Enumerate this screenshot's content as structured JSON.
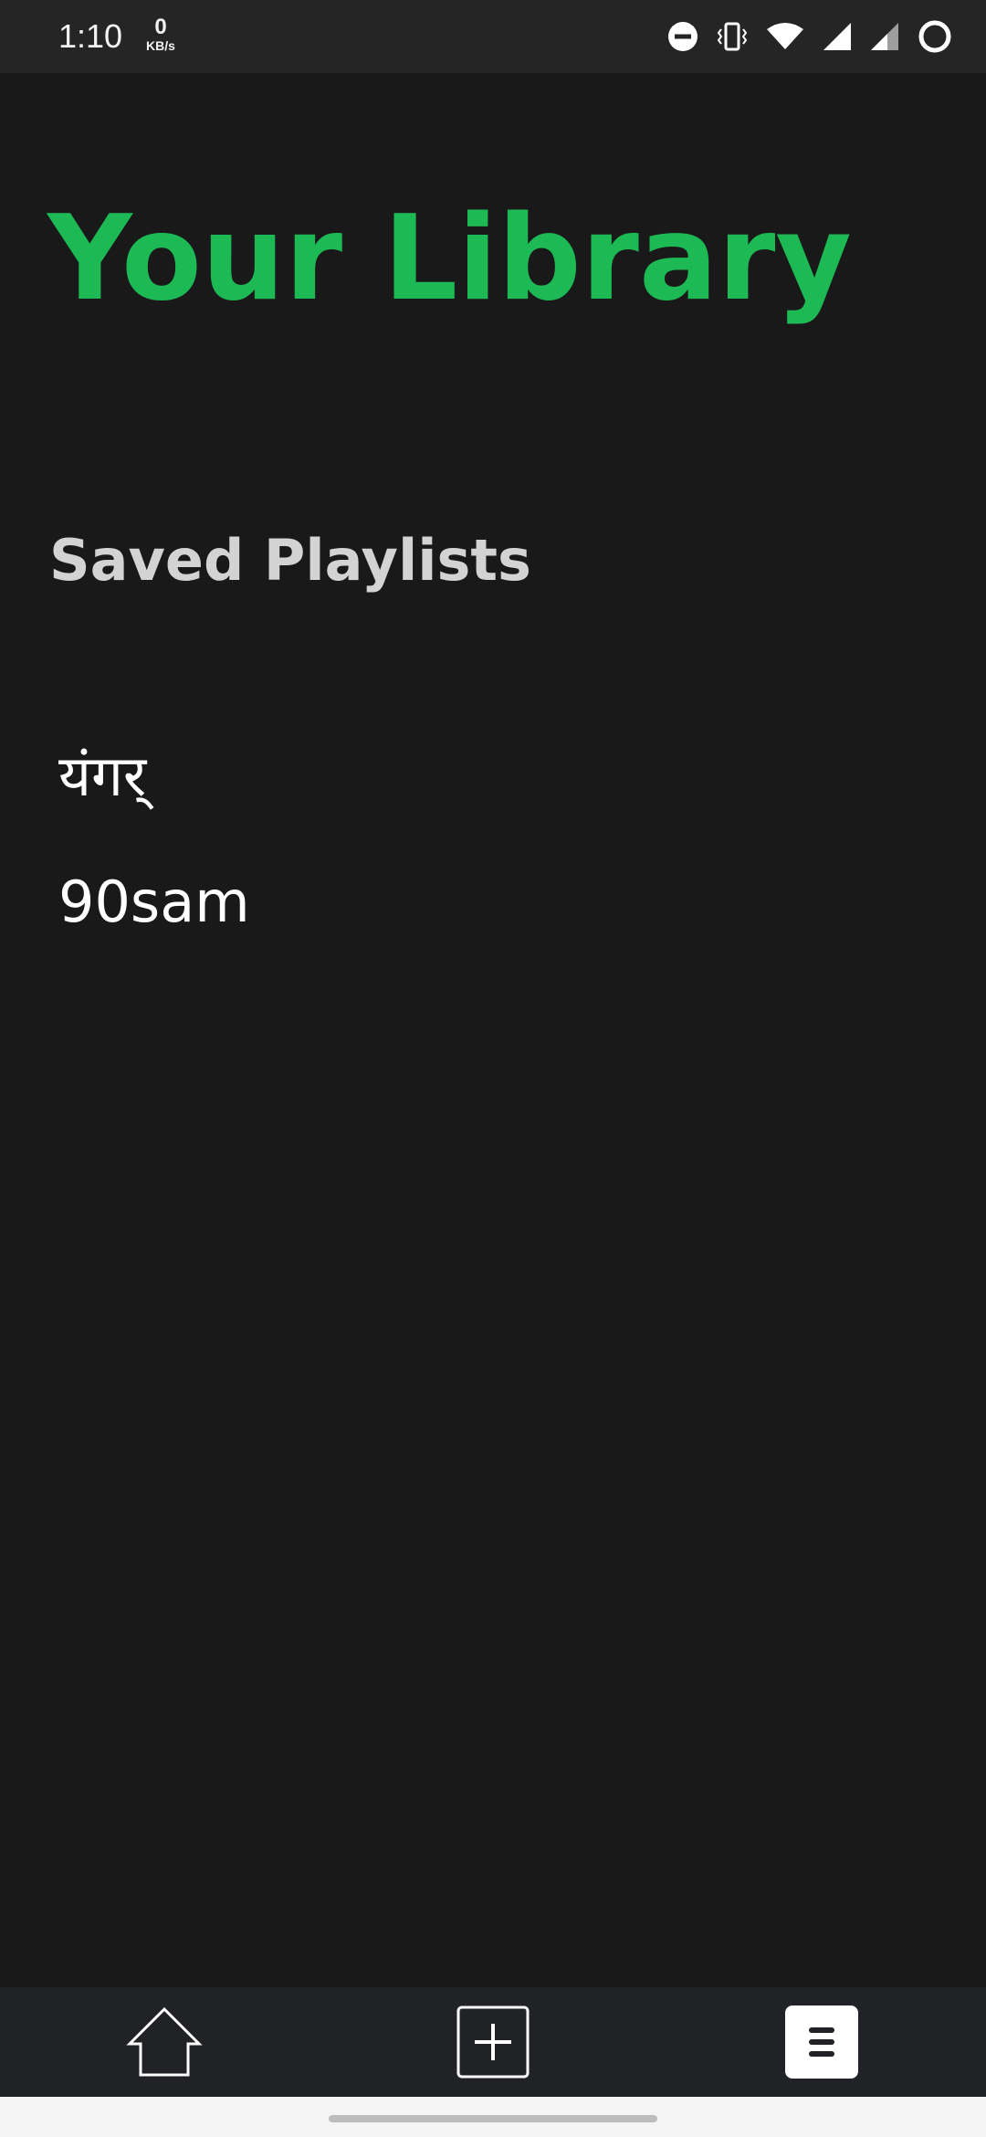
{
  "status_bar": {
    "time": "1:10",
    "net_speed_value": "0",
    "net_speed_unit": "KB/s",
    "icons": [
      "do-not-disturb-icon",
      "vibrate-icon",
      "wifi-icon",
      "signal-icon",
      "signal-icon",
      "battery-ring-icon"
    ]
  },
  "library": {
    "title": "Your Library",
    "saved_playlists_label": "Saved Playlists",
    "playlists": [
      "यंगर्",
      "90sam"
    ]
  },
  "bottom_nav": {
    "items": [
      "home-icon",
      "add-icon",
      "library-menu-icon"
    ]
  },
  "colors": {
    "accent": "#1db954",
    "background": "#191919",
    "nav_background": "#212225"
  }
}
